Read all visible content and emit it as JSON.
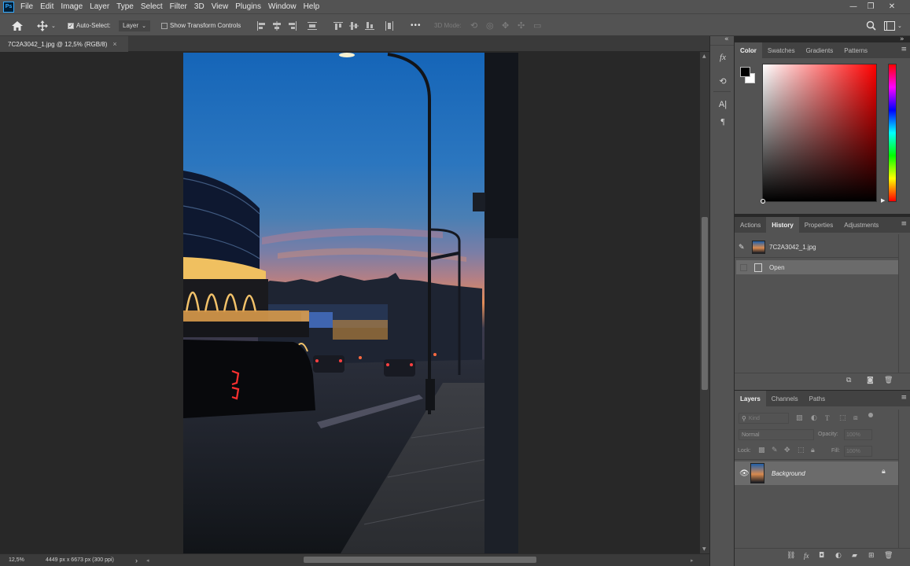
{
  "app": {
    "name_short": "Ps"
  },
  "menu": [
    "File",
    "Edit",
    "Image",
    "Layer",
    "Type",
    "Select",
    "Filter",
    "3D",
    "View",
    "Plugins",
    "Window",
    "Help"
  ],
  "window_controls": {
    "minimize": "—",
    "restore": "❐",
    "close": "✕"
  },
  "options": {
    "auto_select_label": "Auto-Select:",
    "auto_select_checked": true,
    "auto_select_target": "Layer",
    "transform_controls_label": "Show Transform Controls",
    "more": "•••",
    "mode_3d_label": "3D Mode:"
  },
  "document": {
    "tab_title": "7C2A3042_1.jpg @ 12,5% (RGB/8)",
    "close": "×"
  },
  "status": {
    "zoom": "12,5%",
    "doc_info": "4449 px x 6673 px (300 ppi)",
    "arrow": "›"
  },
  "side_column": {
    "collapse": "«",
    "fx": "fx",
    "type_icon": "A|",
    "paragraph_icon": "¶"
  },
  "panels": {
    "collapse": "»",
    "color": {
      "tabs": [
        "Color",
        "Swatches",
        "Gradients",
        "Patterns"
      ],
      "active": 0,
      "foreground": "#000000",
      "background": "#ffffff",
      "hue": "#ff0000"
    },
    "history": {
      "tabs": [
        "Actions",
        "History",
        "Properties",
        "Adjustments"
      ],
      "active": 1,
      "snapshot": "7C2A3042_1.jpg",
      "steps": [
        "Open"
      ]
    },
    "layers": {
      "tabs": [
        "Layers",
        "Channels",
        "Paths"
      ],
      "active": 0,
      "filter_placeholder": "Kind",
      "blend_mode": "Normal",
      "opacity_label": "Opacity:",
      "opacity_value": "100%",
      "lock_label": "Lock:",
      "fill_label": "Fill:",
      "fill_value": "100%",
      "items": [
        {
          "name": "Background",
          "visible": true,
          "locked": true
        }
      ]
    }
  }
}
